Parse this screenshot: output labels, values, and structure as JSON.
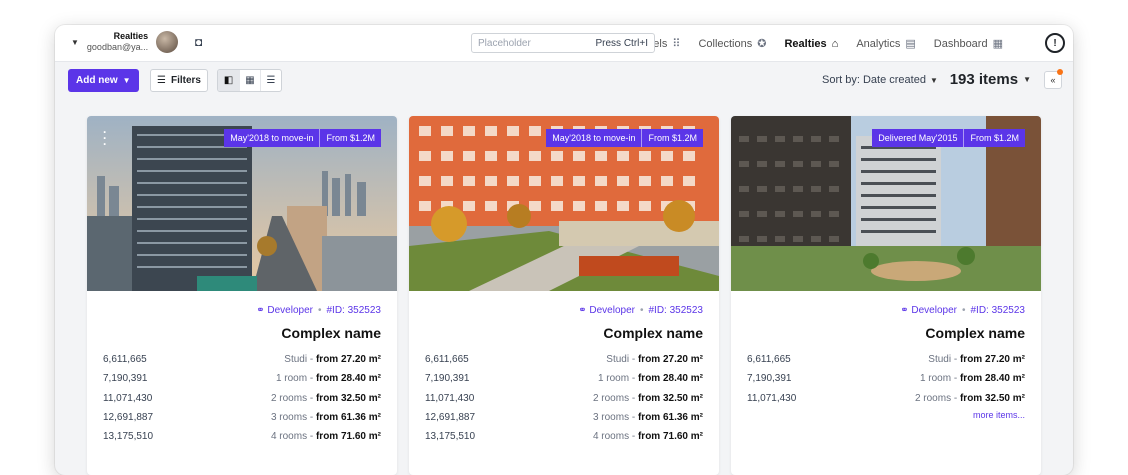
{
  "app": {
    "logo_icon": "app-logo-icon",
    "nav": [
      {
        "label": "Dashboard",
        "icon": "grid-icon"
      },
      {
        "label": "Analytics",
        "icon": "chart-icon"
      },
      {
        "label": "Realties",
        "icon": "home-icon",
        "active": true
      },
      {
        "label": "Collections",
        "icon": "star-circle-icon"
      },
      {
        "label": "Channels",
        "icon": "dots-grid-icon"
      }
    ],
    "search": {
      "placeholder": "Placeholder",
      "shortcut": "Press Ctrl+I"
    },
    "user": {
      "name": "Realties",
      "email": "goodban@ya..."
    }
  },
  "toolbar": {
    "count": "193 items",
    "sort": "Sort by: Date created",
    "filters": "Filters",
    "add": "Add new"
  },
  "cards": [
    {
      "badges": [
        "From $1.2M",
        "Delivered May'2015"
      ],
      "id": "#ID: 352523",
      "developer": "Developer",
      "name": "Complex name",
      "rows": [
        {
          "type": "Studi - ",
          "from": "from 27.20 m²",
          "price": "6,611,665"
        },
        {
          "type": "1 room - ",
          "from": "from 28.40 m²",
          "price": "7,190,391"
        },
        {
          "type": "2 rooms - ",
          "from": "from 32.50 m²",
          "price": "11,071,430"
        }
      ],
      "more": "more items..."
    },
    {
      "badges": [
        "From $1.2M",
        "May'2018 to move-in"
      ],
      "id": "#ID: 352523",
      "developer": "Developer",
      "name": "Complex name",
      "rows": [
        {
          "type": "Studi - ",
          "from": "from 27.20 m²",
          "price": "6,611,665"
        },
        {
          "type": "1 room - ",
          "from": "from 28.40 m²",
          "price": "7,190,391"
        },
        {
          "type": "2 rooms - ",
          "from": "from 32.50 m²",
          "price": "11,071,430"
        },
        {
          "type": "3 rooms - ",
          "from": "from 61.36 m²",
          "price": "12,691,887"
        },
        {
          "type": "4 rooms - ",
          "from": "from 71.60 m²",
          "price": "13,175,510"
        }
      ]
    },
    {
      "badges": [
        "From $1.2M",
        "May'2018 to move-in"
      ],
      "id": "#ID: 352523",
      "developer": "Developer",
      "name": "Complex name",
      "rows": [
        {
          "type": "Studi - ",
          "from": "from 27.20 m²",
          "price": "6,611,665"
        },
        {
          "type": "1 room - ",
          "from": "from 28.40 m²",
          "price": "7,190,391"
        },
        {
          "type": "2 rooms - ",
          "from": "from 32.50 m²",
          "price": "11,071,430"
        },
        {
          "type": "3 rooms - ",
          "from": "from 61.36 m²",
          "price": "12,691,887"
        },
        {
          "type": "4 rooms - ",
          "from": "from 71.60 m²",
          "price": "13,175,510"
        }
      ]
    }
  ]
}
